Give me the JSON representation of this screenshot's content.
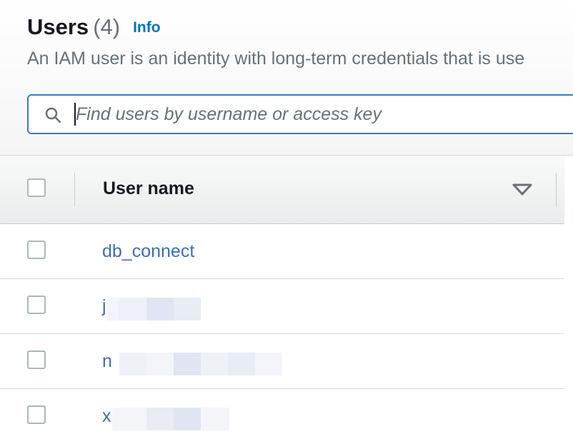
{
  "header": {
    "title": "Users",
    "count": "(4)",
    "info_link": "Info",
    "description": "An IAM user is an identity with long-term credentials that is use"
  },
  "search": {
    "placeholder": "Find users by username or access key",
    "value": "",
    "icon": "search-icon"
  },
  "table": {
    "columns": [
      {
        "label": "User name",
        "sort_icon": "sort-descending-icon"
      }
    ],
    "rows": [
      {
        "user_name": "db_connect",
        "redacted": false
      },
      {
        "user_name": "j",
        "redacted": true
      },
      {
        "user_name": "n",
        "redacted": true
      },
      {
        "user_name": "x",
        "redacted": true
      }
    ]
  },
  "colors": {
    "title": "#16191f",
    "muted": "#687078",
    "link": "#0073bb",
    "user_link": "#3f6db3",
    "search_border": "#3b7bbf"
  }
}
